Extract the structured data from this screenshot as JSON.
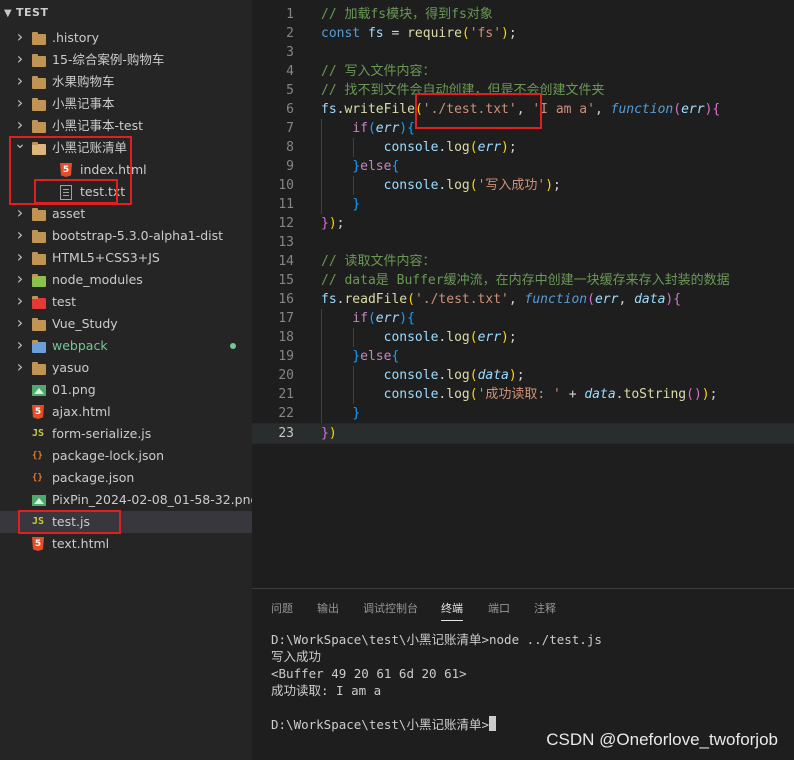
{
  "explorer": {
    "root_label": "TEST",
    "items": [
      {
        "name": ".history",
        "kind": "folder",
        "expanded": false,
        "depth": 0,
        "icon": "folder-icon"
      },
      {
        "name": "15-综合案例-购物车",
        "kind": "folder",
        "expanded": false,
        "depth": 0,
        "icon": "folder-icon"
      },
      {
        "name": "水果购物车",
        "kind": "folder",
        "expanded": false,
        "depth": 0,
        "icon": "folder-icon"
      },
      {
        "name": "小黑记事本",
        "kind": "folder",
        "expanded": false,
        "depth": 0,
        "icon": "folder-icon"
      },
      {
        "name": "小黑记事本-test",
        "kind": "folder",
        "expanded": false,
        "depth": 0,
        "icon": "folder-icon"
      },
      {
        "name": "小黑记账清单",
        "kind": "folder",
        "expanded": true,
        "depth": 0,
        "icon": "folder-open-icon"
      },
      {
        "name": "index.html",
        "kind": "file",
        "depth": 1,
        "icon": "html-file-icon"
      },
      {
        "name": "test.txt",
        "kind": "file",
        "depth": 1,
        "icon": "text-file-icon"
      },
      {
        "name": "asset",
        "kind": "folder",
        "expanded": false,
        "depth": 0,
        "icon": "folder-icon"
      },
      {
        "name": "bootstrap-5.3.0-alpha1-dist",
        "kind": "folder",
        "expanded": false,
        "depth": 0,
        "icon": "folder-icon"
      },
      {
        "name": "HTML5+CSS3+JS",
        "kind": "folder",
        "expanded": false,
        "depth": 0,
        "icon": "folder-icon"
      },
      {
        "name": "node_modules",
        "kind": "folder",
        "expanded": false,
        "depth": 0,
        "icon": "node-modules-folder-icon"
      },
      {
        "name": "test",
        "kind": "folder",
        "expanded": false,
        "depth": 0,
        "icon": "test-folder-icon"
      },
      {
        "name": "Vue_Study",
        "kind": "folder",
        "expanded": false,
        "depth": 0,
        "icon": "folder-icon"
      },
      {
        "name": "webpack",
        "kind": "folder",
        "expanded": false,
        "depth": 0,
        "icon": "webpack-folder-icon",
        "modified": true
      },
      {
        "name": "yasuo",
        "kind": "folder",
        "expanded": false,
        "depth": 0,
        "icon": "folder-icon"
      },
      {
        "name": "01.png",
        "kind": "file",
        "depth": 0,
        "icon": "image-file-icon"
      },
      {
        "name": "ajax.html",
        "kind": "file",
        "depth": 0,
        "icon": "html-file-icon"
      },
      {
        "name": "form-serialize.js",
        "kind": "file",
        "depth": 0,
        "icon": "js-file-icon"
      },
      {
        "name": "package-lock.json",
        "kind": "file",
        "depth": 0,
        "icon": "json-file-icon"
      },
      {
        "name": "package.json",
        "kind": "file",
        "depth": 0,
        "icon": "json-file-icon"
      },
      {
        "name": "PixPin_2024-02-08_01-58-32.png",
        "kind": "file",
        "depth": 0,
        "icon": "image-file-icon"
      },
      {
        "name": "test.js",
        "kind": "file",
        "depth": 0,
        "icon": "js-file-icon",
        "selected": true
      },
      {
        "name": "text.html",
        "kind": "file",
        "depth": 0,
        "icon": "html-file-icon"
      }
    ]
  },
  "editor": {
    "active_line": 23,
    "lines": [
      {
        "n": "1",
        "tokens": [
          [
            "c-comment",
            "// 加载fs模块，得到fs对象"
          ]
        ]
      },
      {
        "n": "2",
        "tokens": [
          [
            "c-key",
            "const "
          ],
          [
            "c-var",
            "fs"
          ],
          [
            "c-punc",
            " = "
          ],
          [
            "c-fn",
            "require"
          ],
          [
            "c-b1",
            "("
          ],
          [
            "c-str",
            "'fs'"
          ],
          [
            "c-b1",
            ")"
          ],
          [
            "c-punc",
            ";"
          ]
        ]
      },
      {
        "n": "3",
        "tokens": []
      },
      {
        "n": "4",
        "tokens": [
          [
            "c-comment",
            "// 写入文件内容："
          ]
        ]
      },
      {
        "n": "5",
        "tokens": [
          [
            "c-comment",
            "// 找不到文件会自动创建，但是不会创建文件夹"
          ]
        ]
      },
      {
        "n": "6",
        "tokens": [
          [
            "c-var",
            "fs"
          ],
          [
            "c-punc",
            "."
          ],
          [
            "c-fn",
            "writeFile"
          ],
          [
            "c-b1",
            "("
          ],
          [
            "c-str",
            "'./test.txt'"
          ],
          [
            "c-punc",
            ", "
          ],
          [
            "c-str",
            "'I am a'"
          ],
          [
            "c-punc",
            ", "
          ],
          [
            "c-kfn",
            "function"
          ],
          [
            "c-b2",
            "("
          ],
          [
            "c-param",
            "err"
          ],
          [
            "c-b2",
            ")"
          ],
          [
            "c-b2",
            "{"
          ]
        ]
      },
      {
        "n": "7",
        "tokens": [
          [
            "c-punc",
            "    "
          ],
          [
            "c-ctrl",
            "if"
          ],
          [
            "c-b3",
            "("
          ],
          [
            "c-param",
            "err"
          ],
          [
            "c-b3",
            ")"
          ],
          [
            "c-b3",
            "{"
          ]
        ]
      },
      {
        "n": "8",
        "tokens": [
          [
            "c-punc",
            "        "
          ],
          [
            "c-var",
            "console"
          ],
          [
            "c-punc",
            "."
          ],
          [
            "c-fn",
            "log"
          ],
          [
            "c-b1",
            "("
          ],
          [
            "c-param",
            "err"
          ],
          [
            "c-b1",
            ")"
          ],
          [
            "c-punc",
            ";"
          ]
        ]
      },
      {
        "n": "9",
        "tokens": [
          [
            "c-punc",
            "    "
          ],
          [
            "c-b3",
            "}"
          ],
          [
            "c-ctrl",
            "else"
          ],
          [
            "c-b3",
            "{"
          ]
        ]
      },
      {
        "n": "10",
        "tokens": [
          [
            "c-punc",
            "        "
          ],
          [
            "c-var",
            "console"
          ],
          [
            "c-punc",
            "."
          ],
          [
            "c-fn",
            "log"
          ],
          [
            "c-b1",
            "("
          ],
          [
            "c-str",
            "'写入成功'"
          ],
          [
            "c-b1",
            ")"
          ],
          [
            "c-punc",
            ";"
          ]
        ]
      },
      {
        "n": "11",
        "tokens": [
          [
            "c-punc",
            "    "
          ],
          [
            "c-b3",
            "}"
          ]
        ]
      },
      {
        "n": "12",
        "tokens": [
          [
            "c-b2",
            "}"
          ],
          [
            "c-b1",
            ")"
          ],
          [
            "c-punc",
            ";"
          ]
        ]
      },
      {
        "n": "13",
        "tokens": []
      },
      {
        "n": "14",
        "tokens": [
          [
            "c-comment",
            "// 读取文件内容："
          ]
        ]
      },
      {
        "n": "15",
        "tokens": [
          [
            "c-comment",
            "// data是 Buffer缓冲流，在内存中创建一块缓存来存入封装的数据"
          ]
        ]
      },
      {
        "n": "16",
        "tokens": [
          [
            "c-var",
            "fs"
          ],
          [
            "c-punc",
            "."
          ],
          [
            "c-fn",
            "readFile"
          ],
          [
            "c-b1",
            "("
          ],
          [
            "c-str",
            "'./test.txt'"
          ],
          [
            "c-punc",
            ", "
          ],
          [
            "c-kfn",
            "function"
          ],
          [
            "c-b2",
            "("
          ],
          [
            "c-param",
            "err"
          ],
          [
            "c-punc",
            ", "
          ],
          [
            "c-param",
            "data"
          ],
          [
            "c-b2",
            ")"
          ],
          [
            "c-b2",
            "{"
          ]
        ]
      },
      {
        "n": "17",
        "tokens": [
          [
            "c-punc",
            "    "
          ],
          [
            "c-ctrl",
            "if"
          ],
          [
            "c-b3",
            "("
          ],
          [
            "c-param",
            "err"
          ],
          [
            "c-b3",
            ")"
          ],
          [
            "c-b3",
            "{"
          ]
        ]
      },
      {
        "n": "18",
        "tokens": [
          [
            "c-punc",
            "        "
          ],
          [
            "c-var",
            "console"
          ],
          [
            "c-punc",
            "."
          ],
          [
            "c-fn",
            "log"
          ],
          [
            "c-b1",
            "("
          ],
          [
            "c-param",
            "err"
          ],
          [
            "c-b1",
            ")"
          ],
          [
            "c-punc",
            ";"
          ]
        ]
      },
      {
        "n": "19",
        "tokens": [
          [
            "c-punc",
            "    "
          ],
          [
            "c-b3",
            "}"
          ],
          [
            "c-ctrl",
            "else"
          ],
          [
            "c-b3",
            "{"
          ]
        ]
      },
      {
        "n": "20",
        "tokens": [
          [
            "c-punc",
            "        "
          ],
          [
            "c-var",
            "console"
          ],
          [
            "c-punc",
            "."
          ],
          [
            "c-fn",
            "log"
          ],
          [
            "c-b1",
            "("
          ],
          [
            "c-param",
            "data"
          ],
          [
            "c-b1",
            ")"
          ],
          [
            "c-punc",
            ";"
          ]
        ]
      },
      {
        "n": "21",
        "tokens": [
          [
            "c-punc",
            "        "
          ],
          [
            "c-var",
            "console"
          ],
          [
            "c-punc",
            "."
          ],
          [
            "c-fn",
            "log"
          ],
          [
            "c-b1",
            "("
          ],
          [
            "c-str",
            "'成功读取: '"
          ],
          [
            "c-punc",
            " + "
          ],
          [
            "c-param",
            "data"
          ],
          [
            "c-punc",
            "."
          ],
          [
            "c-fn",
            "toString"
          ],
          [
            "c-b2",
            "("
          ],
          [
            "c-b2",
            ")"
          ],
          [
            "c-b1",
            ")"
          ],
          [
            "c-punc",
            ";"
          ]
        ]
      },
      {
        "n": "22",
        "tokens": [
          [
            "c-punc",
            "    "
          ],
          [
            "c-b3",
            "}"
          ]
        ]
      },
      {
        "n": "23",
        "tokens": [
          [
            "c-b2",
            "}"
          ],
          [
            "c-b1",
            ")"
          ]
        ]
      }
    ]
  },
  "panel": {
    "tabs": [
      "问题",
      "输出",
      "调试控制台",
      "终端",
      "端口",
      "注释"
    ],
    "active_tab": "终端",
    "terminal_lines": [
      "D:\\WorkSpace\\test\\小黑记账清单>node ../test.js",
      "写入成功",
      "<Buffer 49 20 61 6d 20 61>",
      "成功读取: I am a",
      "",
      "D:\\WorkSpace\\test\\小黑记账清单>"
    ]
  },
  "watermark": "CSDN @Oneforlove_twoforjob",
  "colors": {
    "sidebar_bg": "#252526",
    "editor_bg": "#1e1e1e",
    "selection_bg": "#37373d",
    "annotation_red": "#e02020",
    "modified_dot": "#73c991",
    "webpack_label": "#73c991"
  }
}
